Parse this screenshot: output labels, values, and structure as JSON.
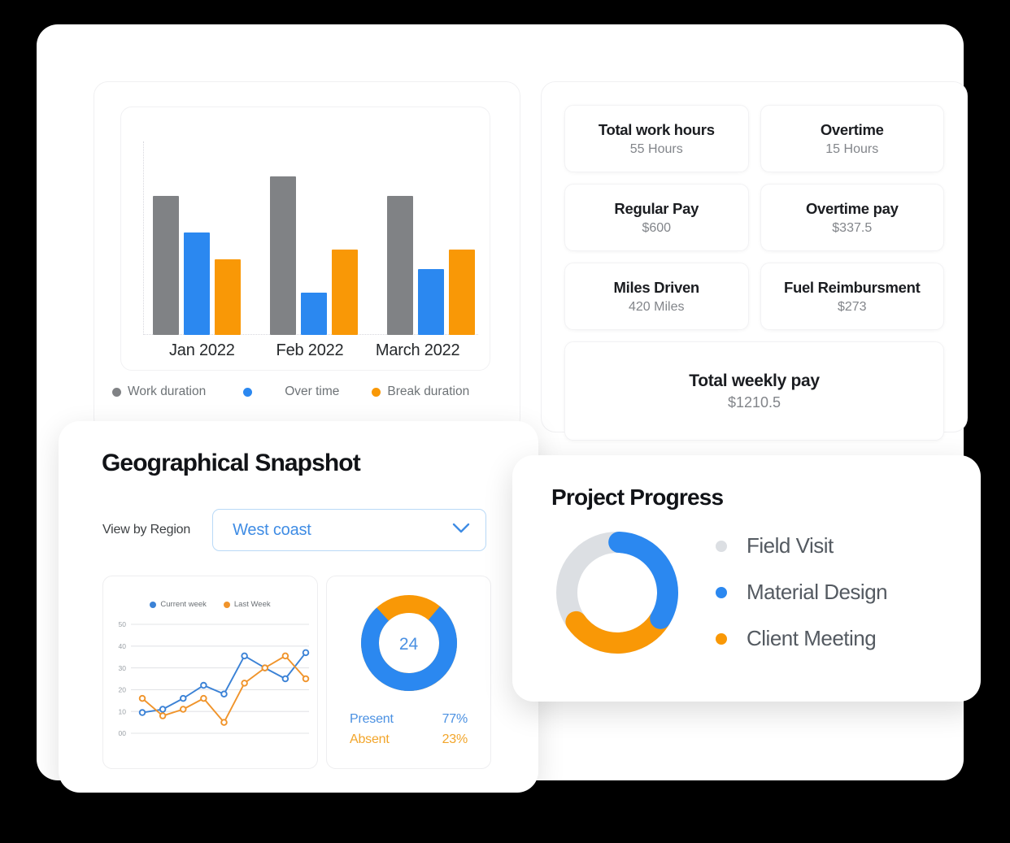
{
  "colors": {
    "gray": "#808285",
    "blue": "#2b88f0",
    "orange": "#F99806",
    "donut_gray": "#dcdfe3",
    "line_blue": "#3b82d6",
    "line_orange": "#f0942b",
    "accent_blue": "#3f8ce4"
  },
  "bar_panel": {
    "legend": [
      {
        "label": "Work duration",
        "color": "#808285",
        "icon": "legend-dot-gray"
      },
      {
        "label": "Over time",
        "color": "#2b88f0",
        "icon": "legend-dot-blue"
      },
      {
        "label": "Break duration",
        "color": "#F99806",
        "icon": "legend-dot-orange"
      }
    ]
  },
  "stats": {
    "cards": [
      {
        "title": "Total work hours",
        "value": "55 Hours"
      },
      {
        "title": "Overtime",
        "value": "15 Hours"
      },
      {
        "title": "Regular Pay",
        "value": "$600"
      },
      {
        "title": "Overtime pay",
        "value": "$337.5"
      },
      {
        "title": "Miles Driven",
        "value": "420 Miles"
      },
      {
        "title": "Fuel Reimbursment",
        "value": "$273"
      }
    ],
    "total": {
      "title": "Total weekly pay",
      "value": "$1210.5"
    }
  },
  "geo": {
    "title": "Geographical Snapshot",
    "filter_label": "View by Region",
    "selected_region": "West coast",
    "region_options": [
      "West coast"
    ],
    "chevron_icon": "chevron-down-icon",
    "attendance": {
      "center_value": "24",
      "rows": [
        {
          "label": "Present",
          "value": "77%",
          "color": "#4a90e2"
        },
        {
          "label": "Absent",
          "value": "23%",
          "color": "#f2a52a"
        }
      ]
    }
  },
  "progress": {
    "title": "Project Progress",
    "legend": [
      {
        "label": "Field Visit",
        "color": "#dcdfe3",
        "icon": "legend-dot-gray"
      },
      {
        "label": "Material Design",
        "color": "#2b88f0",
        "icon": "legend-dot-blue"
      },
      {
        "label": "Client Meeting",
        "color": "#F99806",
        "icon": "legend-dot-orange"
      }
    ]
  },
  "chart_data": [
    {
      "type": "bar",
      "title": "",
      "xlabel": "",
      "ylabel": "",
      "grid": false,
      "legend_position": "bottom",
      "categories": [
        "Jan 2022",
        "Feb 2022",
        "March 2022"
      ],
      "ylim": [
        0,
        100
      ],
      "series": [
        {
          "name": "Work duration",
          "color": "#808285",
          "values": [
            72,
            82,
            72
          ]
        },
        {
          "name": "Over time",
          "color": "#2b88f0",
          "values": [
            53,
            22,
            34
          ]
        },
        {
          "name": "Break duration",
          "color": "#F99806",
          "values": [
            39,
            44,
            44
          ]
        }
      ]
    },
    {
      "type": "line",
      "title": "",
      "xlabel": "",
      "ylabel": "",
      "grid": true,
      "legend_position": "top",
      "yticks": [
        "00",
        "10",
        "20",
        "30",
        "40",
        "50"
      ],
      "ylim": [
        0,
        50
      ],
      "x": [
        1,
        2,
        3,
        4,
        5,
        6,
        7,
        8,
        9
      ],
      "series": [
        {
          "name": "Current week",
          "color": "#3b82d6",
          "values": [
            9.5,
            11,
            16,
            22,
            18,
            35.5,
            30,
            25,
            37
          ]
        },
        {
          "name": "Last Week",
          "color": "#f0942b",
          "values": [
            16,
            8,
            11,
            16,
            5,
            23,
            30,
            35.5,
            25
          ]
        }
      ]
    },
    {
      "type": "pie",
      "title": "",
      "center_label": "24",
      "labels": [
        "Present",
        "Absent"
      ],
      "values": [
        77,
        23
      ],
      "colors": [
        "#2b88f0",
        "#F99806"
      ]
    },
    {
      "type": "pie",
      "title": "Project Progress",
      "labels": [
        "Material Design",
        "Client Meeting",
        "Field Visit"
      ],
      "values": [
        33,
        31,
        36
      ],
      "colors": [
        "#2b88f0",
        "#F99806",
        "#dcdfe3"
      ]
    }
  ]
}
